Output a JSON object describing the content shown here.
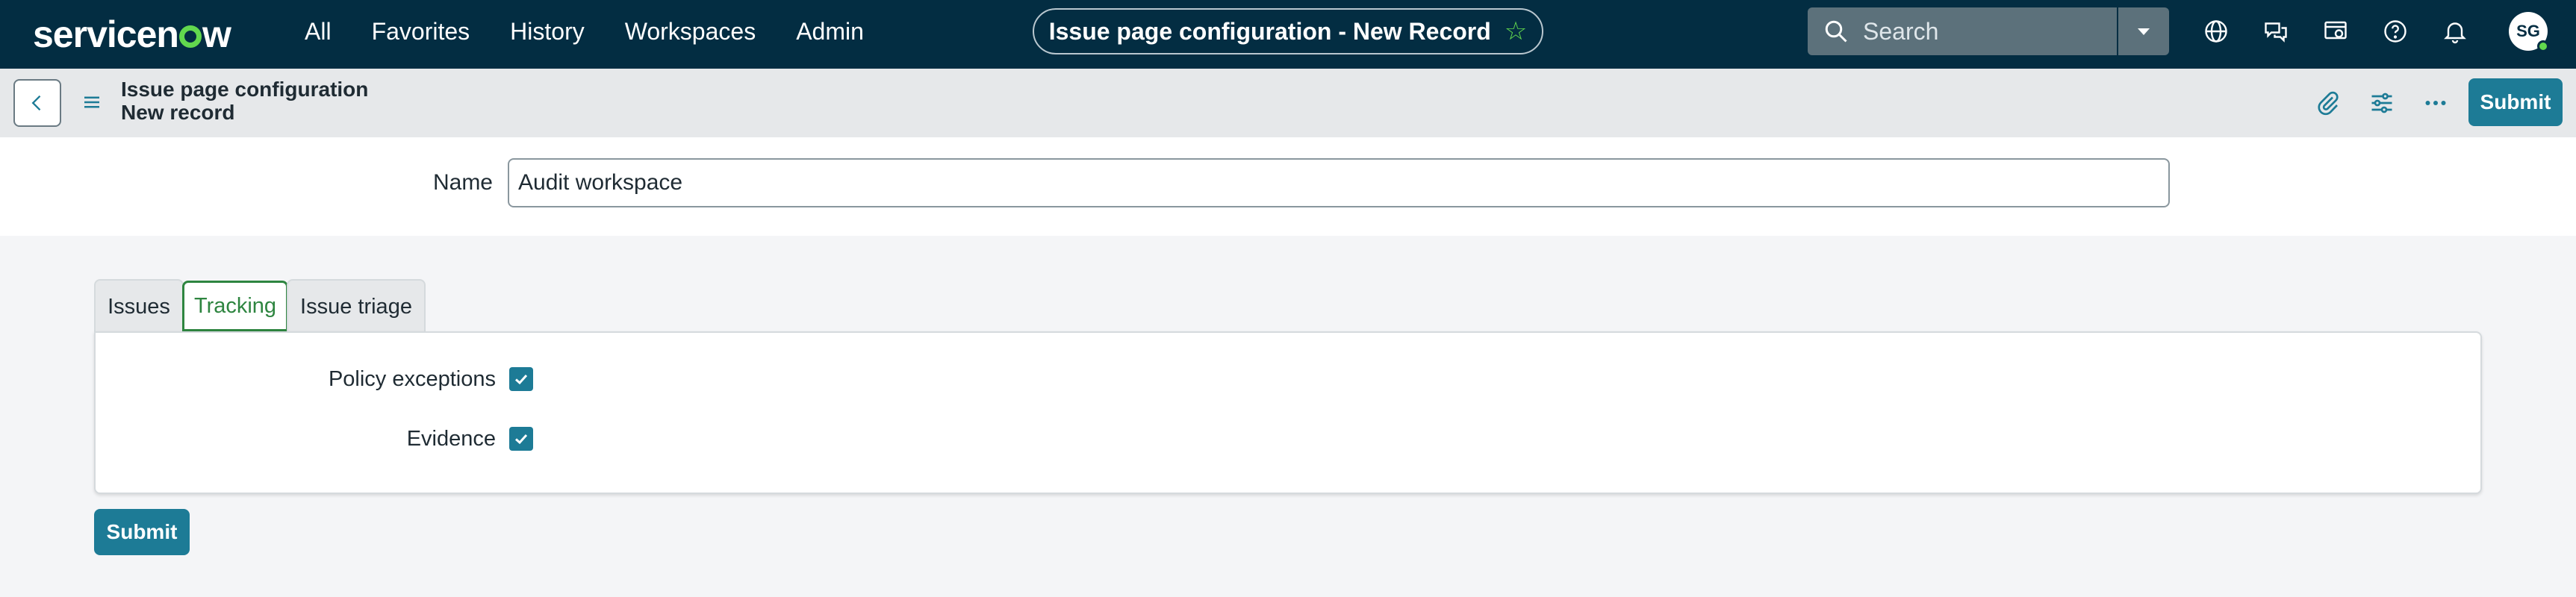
{
  "nav": {
    "logo": "servicenow",
    "links": [
      "All",
      "Favorites",
      "History",
      "Workspaces",
      "Admin"
    ],
    "context_title": "Issue page configuration - New Record",
    "search_placeholder": "Search",
    "icons": [
      "globe-icon",
      "chat-icon",
      "screen-icon",
      "help-icon",
      "bell-icon"
    ],
    "avatar_initials": "SG"
  },
  "header": {
    "title": "Issue page configuration",
    "subtitle": "New record",
    "submit_label": "Submit"
  },
  "form": {
    "name_label": "Name",
    "name_value": "Audit workspace",
    "tabs": [
      {
        "label": "Issues",
        "active": false
      },
      {
        "label": "Tracking",
        "active": true
      },
      {
        "label": "Issue triage",
        "active": false
      }
    ],
    "fields": [
      {
        "label": "Policy exceptions",
        "checked": true
      },
      {
        "label": "Evidence",
        "checked": true
      }
    ],
    "submit_label": "Submit"
  },
  "colors": {
    "nav_bg": "#032d42",
    "accent": "#1d7b96",
    "active_tab": "#2e8540",
    "brand_green": "#62d84e"
  }
}
